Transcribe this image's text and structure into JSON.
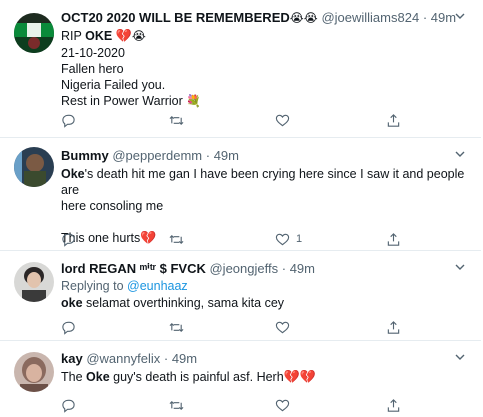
{
  "tweets": [
    {
      "name": "OCT20 2020 WILL BE REMEMBERED",
      "name_emoji": "😭😭",
      "handle": "@joewilliams824",
      "time": "49m",
      "lines": [
        "RIP",
        "21-10-2020",
        "Fallen hero",
        "Nigeria Failed you.",
        "Rest in Power Warrior"
      ],
      "rip_bold": "OKE",
      "likes": ""
    },
    {
      "name": "Bummy",
      "handle": "@pepperdemm",
      "time": "49m",
      "bold": "Oke",
      "line1": "'s death hit me gan I have been crying here since I saw it and people are",
      "line2": "here consoling me",
      "line3": "This one hurts",
      "likes": "1"
    },
    {
      "name": "lord REGAN ᵐⁱᵗʳ $ FVCK",
      "handle": "@jeongjeffs",
      "time": "49m",
      "replying_label": "Replying to",
      "replying_handle": "@eunhaaz",
      "bold": "oke",
      "text": " selamat overthinking, sama kita cey",
      "likes": ""
    },
    {
      "name": "kay",
      "handle": "@wannyfelix",
      "time": "49m",
      "pre": "The ",
      "bold": "Oke",
      "text": " guy's death is painful asf. Herh",
      "likes": ""
    }
  ],
  "dot": "·",
  "icons": [
    "reply-icon",
    "retweet-icon",
    "like-icon",
    "share-icon",
    "chevron-down-icon"
  ]
}
